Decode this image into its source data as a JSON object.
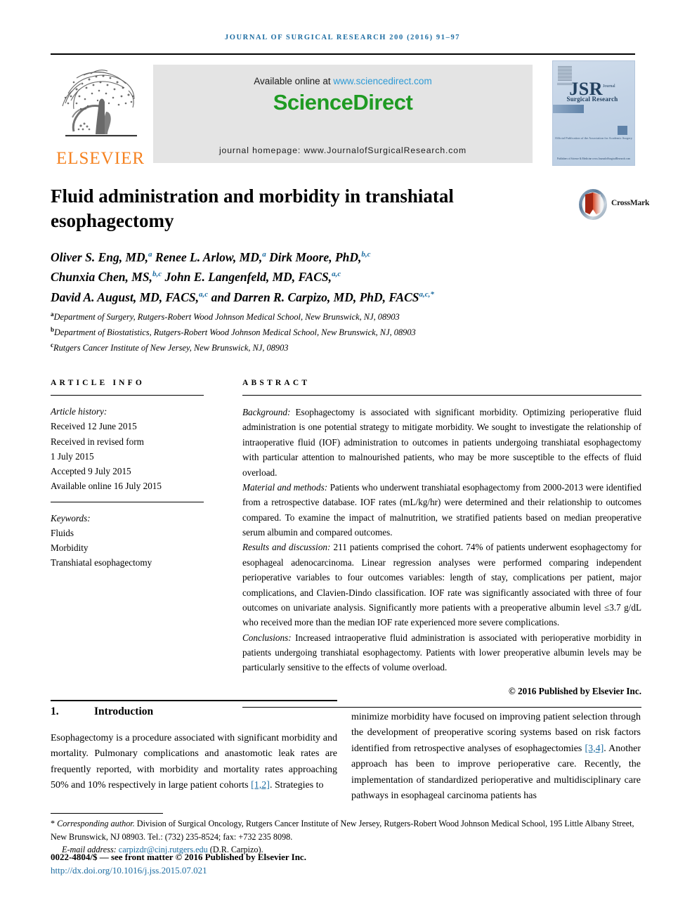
{
  "running_head": "Journal of Surgical Research 200 (2016) 91–97",
  "masthead": {
    "elsevier_wordmark": "ELSEVIER",
    "available_online_prefix": "Available online at ",
    "sciencedirect_url": "www.sciencedirect.com",
    "sciencedirect_logo": "ScienceDirect",
    "journal_homepage": "journal homepage: www.JournalofSurgicalResearch.com",
    "cover": {
      "acronym": "JSR",
      "acronym_small": "Journal",
      "subtitle": "Surgical Research",
      "official_publication": "Official Publication of the Association for Academic Surgery",
      "footer": "Publishers of Science & Medicine www.JournalofSurgicalResearch.com"
    }
  },
  "article": {
    "title": "Fluid administration and morbidity in transhiatal esophagectomy",
    "crossmark_label": "CrossMark",
    "authors_lines": [
      {
        "parts": [
          {
            "text": "Oliver S. Eng, MD,",
            "sup": "a"
          },
          {
            "text": " Renee L. Arlow, MD,",
            "sup": "a"
          },
          {
            "text": " Dirk Moore, PhD,",
            "sup": "b,c"
          }
        ]
      },
      {
        "parts": [
          {
            "text": "Chunxia Chen, MS,",
            "sup": "b,c"
          },
          {
            "text": " John E. Langenfeld, MD, FACS,",
            "sup": "a,c"
          }
        ]
      },
      {
        "parts": [
          {
            "text": "David A. August, MD, FACS,",
            "sup": "a,c"
          },
          {
            "text": " and Darren R. Carpizo, MD, PhD, FACS",
            "sup": "a,c,*"
          }
        ]
      }
    ],
    "affiliations": [
      {
        "mark": "a",
        "text": "Department of Surgery, Rutgers-Robert Wood Johnson Medical School, New Brunswick, NJ, 08903"
      },
      {
        "mark": "b",
        "text": "Department of Biostatistics, Rutgers-Robert Wood Johnson Medical School, New Brunswick, NJ, 08903"
      },
      {
        "mark": "c",
        "text": "Rutgers Cancer Institute of New Jersey, New Brunswick, NJ, 08903"
      }
    ]
  },
  "article_info": {
    "heading": "ARTICLE INFO",
    "history_label": "Article history:",
    "history": [
      "Received 12 June 2015",
      "Received in revised form",
      "1 July 2015",
      "Accepted 9 July 2015",
      "Available online 16 July 2015"
    ],
    "keywords_label": "Keywords:",
    "keywords": [
      "Fluids",
      "Morbidity",
      "Transhiatal esophagectomy"
    ]
  },
  "abstract": {
    "heading": "ABSTRACT",
    "sections": [
      {
        "lead": "Background:",
        "text": " Esophagectomy is associated with significant morbidity. Optimizing perioperative fluid administration is one potential strategy to mitigate morbidity. We sought to investigate the relationship of intraoperative fluid (IOF) administration to outcomes in patients undergoing transhiatal esophagectomy with particular attention to malnourished patients, who may be more susceptible to the effects of fluid overload."
      },
      {
        "lead": "Material and methods:",
        "text": " Patients who underwent transhiatal esophagectomy from 2000-2013 were identified from a retrospective database. IOF rates (mL/kg/hr) were determined and their relationship to outcomes compared. To examine the impact of malnutrition, we stratified patients based on median preoperative serum albumin and compared outcomes."
      },
      {
        "lead": "Results and discussion:",
        "text": " 211 patients comprised the cohort. 74% of patients underwent esophagectomy for esophageal adenocarcinoma. Linear regression analyses were performed comparing independent perioperative variables to four outcomes variables: length of stay, complications per patient, major complications, and Clavien-Dindo classification. IOF rate was significantly associated with three of four outcomes on univariate analysis. Significantly more patients with a preoperative albumin level ≤3.7 g/dL who received more than the median IOF rate experienced more severe complications."
      },
      {
        "lead": "Conclusions:",
        "text": " Increased intraoperative fluid administration is associated with perioperative morbidity in patients undergoing transhiatal esophagectomy. Patients with lower preoperative albumin levels may be particularly sensitive to the effects of volume overload."
      }
    ],
    "copyright": "© 2016 Published by Elsevier Inc."
  },
  "introduction": {
    "number": "1.",
    "title": "Introduction",
    "left_text_before_cite": "Esophagectomy is a procedure associated with significant morbidity and mortality. Pulmonary complications and anastomotic leak rates are frequently reported, with morbidity and mortality rates approaching 50% and 10% respectively in large patient cohorts ",
    "left_citation": "[1,2]",
    "left_text_after_cite": ". Strategies to",
    "right_text_before_cite": "minimize morbidity have focused on improving patient selection through the development of preoperative scoring systems based on risk factors identified from retrospective analyses of esophagectomies ",
    "right_citation": "[3,4]",
    "right_text_after_cite": ". Another approach has been to improve perioperative care. Recently, the implementation of standardized perioperative and multidisciplinary care pathways in esophageal carcinoma patients has"
  },
  "footnotes": {
    "corresponding_marker": "*",
    "corresponding_label": "Corresponding author.",
    "corresponding_text": " Division of Surgical Oncology, Rutgers Cancer Institute of New Jersey, Rutgers-Robert Wood Johnson Medical School, 195 Little Albany Street, New Brunswick, NJ 08903. Tel.: (732) 235-8524; fax: +732 235 8098.",
    "email_label": "E-mail address: ",
    "email": "carpizdr@cinj.rutgers.edu",
    "email_suffix": " (D.R. Carpizo).",
    "issn_line": "0022-4804/$ — see front matter © 2016 Published by Elsevier Inc.",
    "doi": "http://dx.doi.org/10.1016/j.jss.2015.07.021"
  },
  "colors": {
    "link_blue": "#1c6ca1",
    "sciencedirect_green": "#1f9b23",
    "sciencedirect_link": "#2e9bd6",
    "elsevier_orange": "#F58220",
    "banner_gray": "#e4e4e4",
    "cover_blue": "#23415f"
  }
}
